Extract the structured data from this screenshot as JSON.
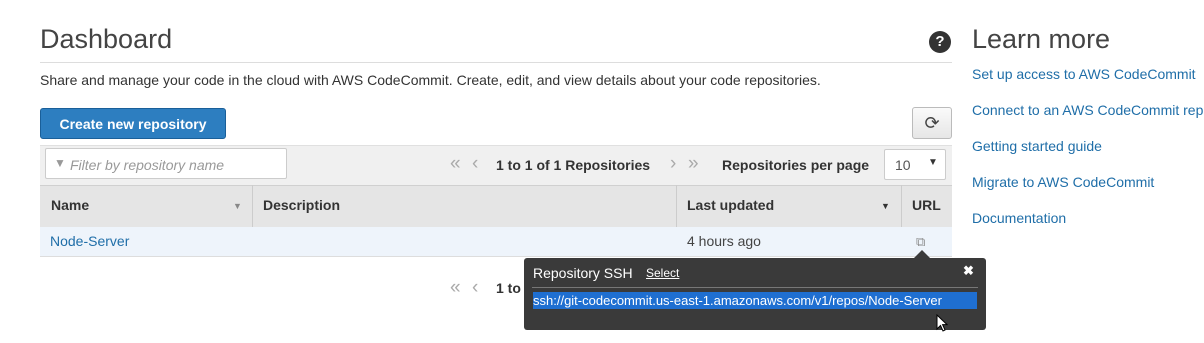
{
  "header": {
    "title": "Dashboard",
    "help_glyph": "?",
    "description": "Share and manage your code in the cloud with AWS CodeCommit. Create, edit, and view details about your code repositories."
  },
  "toolbar": {
    "create_label": "Create new repository",
    "refresh_icon": "refresh-icon",
    "filter_placeholder": "Filter by repository name",
    "pagination_text": "1 to 1 of 1 Repositories",
    "per_page_label": "Repositories per page",
    "per_page_value": "10"
  },
  "table": {
    "columns": [
      "Name",
      "Description",
      "Last updated",
      "URL"
    ],
    "rows": [
      {
        "name": "Node-Server",
        "description": "",
        "last_updated": "4 hours ago"
      }
    ]
  },
  "bottom_pager": {
    "text": "1 to"
  },
  "learn_more": {
    "title": "Learn more",
    "links": [
      "Set up access to AWS CodeCommit",
      "Connect to an AWS CodeCommit rep",
      "Getting started guide",
      "Migrate to AWS CodeCommit",
      "Documentation"
    ]
  },
  "popup": {
    "title": "Repository SSH",
    "select_label": "Select",
    "close_glyph": "✖",
    "url": "ssh://git-codecommit.us-east-1.amazonaws.com/v1/repos/Node-Server"
  },
  "colors": {
    "primary_button": "#2d7ec0",
    "link": "#1f6ea8",
    "popup_bg": "#3a3a3a",
    "selection": "#1f6fd1"
  }
}
